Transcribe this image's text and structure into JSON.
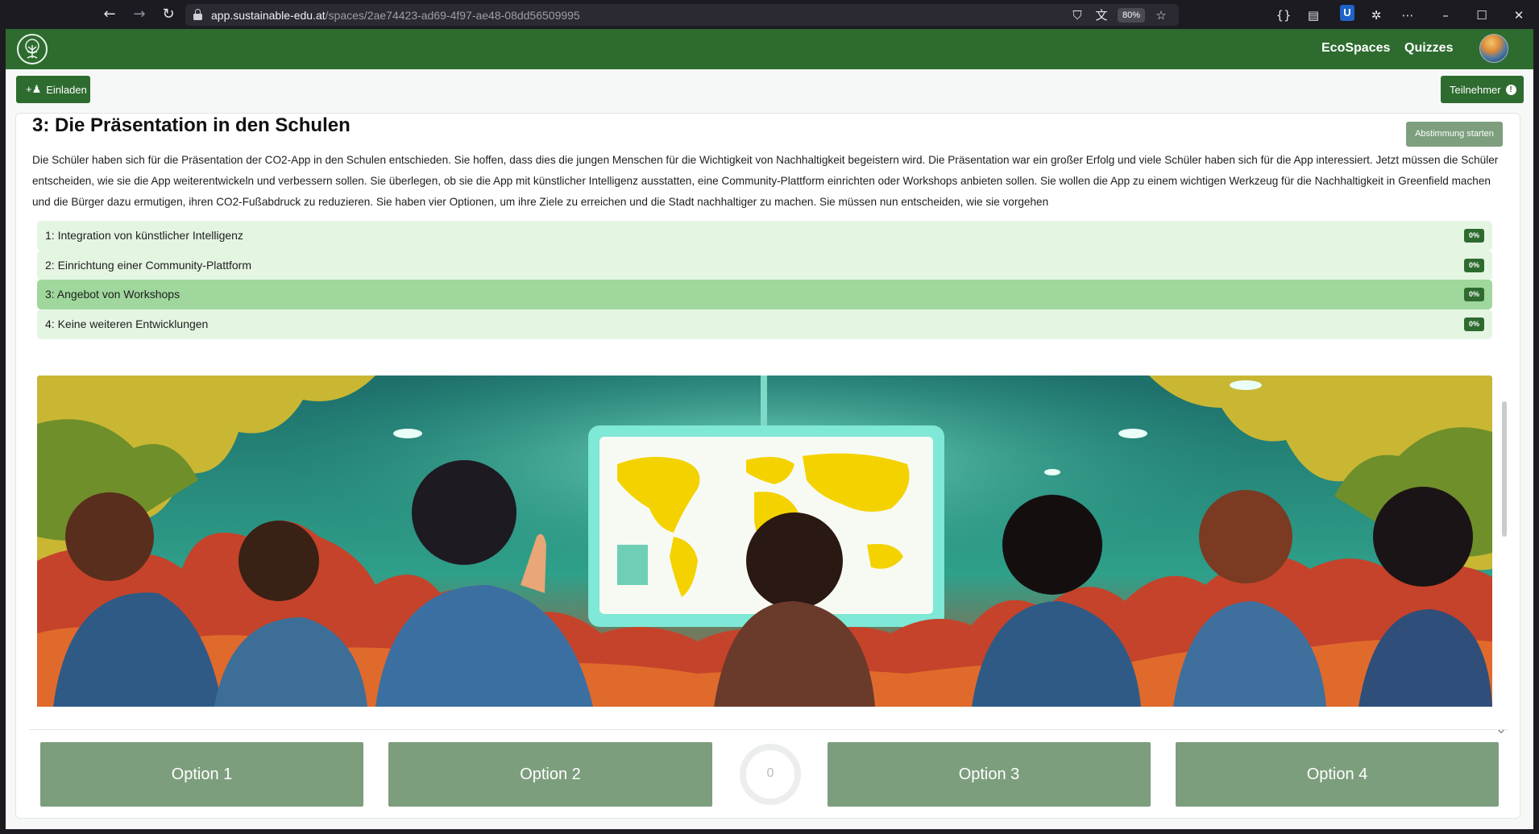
{
  "browser": {
    "url_host": "app.sustainable-edu.at",
    "url_path": "/spaces/2ae74423-ad69-4f97-ae48-08dd56509995",
    "zoom": "80%"
  },
  "header": {
    "nav": [
      "EcoSpaces",
      "Quizzes"
    ]
  },
  "toolbar": {
    "invite_label": "Einladen",
    "participants_label": "Teilnehmer",
    "participants_info": "!"
  },
  "question": {
    "title": "3: Die Präsentation in den Schulen",
    "start_vote_label": "Abstimmung starten",
    "description": "Die Schüler haben sich für die Präsentation der CO2-App in den Schulen entschieden. Sie hoffen, dass dies die jungen Menschen für die Wichtigkeit von Nachhaltigkeit begeistern wird. Die Präsentation war ein großer Erfolg und viele Schüler haben sich für die App interessiert. Jetzt müssen die Schüler entscheiden, wie sie die App weiterentwickeln und verbessern sollen. Sie überlegen, ob sie die App mit künstlicher Intelligenz ausstatten, eine Community-Plattform einrichten oder Workshops anbieten sollen. Sie wollen die App zu einem wichtigen Werkzeug für die Nachhaltigkeit in Greenfield machen und die Bürger dazu ermutigen, ihren CO2-Fußabdruck zu reduzieren. Sie haben vier Optionen, um ihre Ziele zu erreichen und die Stadt nachhaltiger zu machen. Sie müssen nun entscheiden, wie sie vorgehen",
    "options": [
      {
        "label": "1: Integration von künstlicher Intelligenz",
        "percent": "0%",
        "selected": false
      },
      {
        "label": "2: Einrichtung einer Community-Plattform",
        "percent": "0%",
        "selected": false
      },
      {
        "label": "3: Angebot von Workshops",
        "percent": "0%",
        "selected": true
      },
      {
        "label": "4: Keine weiteren Entwicklungen",
        "percent": "0%",
        "selected": false
      }
    ]
  },
  "answers": {
    "buttons": [
      "Option 1",
      "Option 2",
      "Option 3",
      "Option 4"
    ],
    "timer_value": "0"
  },
  "colors": {
    "brand_green": "#2e6b2f",
    "option_bg": "#e4f5e2",
    "option_selected_bg": "#9fd79c",
    "answer_button": "#7c9e7d"
  }
}
